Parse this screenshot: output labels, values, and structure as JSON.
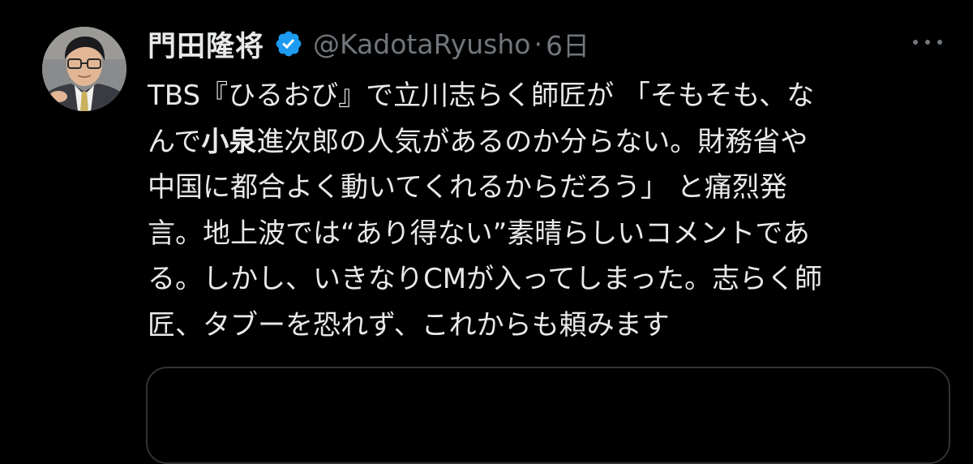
{
  "author": {
    "display_name": "門田隆将",
    "handle": "@KadotaRyusho",
    "separator": "·",
    "time": "6日",
    "verified": true,
    "verified_color": "#1d9bf0"
  },
  "tweet": {
    "lines": [
      [
        {
          "text": "TBS『ひるおび』で立川志らく師匠が 「そもそも、な"
        }
      ],
      [
        {
          "text": "んで"
        },
        {
          "text": "小泉",
          "bold": true
        },
        {
          "text": "進次郎の人気があるのか分らない。財務省や"
        }
      ],
      [
        {
          "text": "中国に都合よく動いてくれるからだろう」 と痛烈発"
        }
      ],
      [
        {
          "text": "言。地上波では“あり得ない”素晴らしいコメントであ"
        }
      ],
      [
        {
          "text": "る。しかし、いきなりCMが入ってしまった。志らく師"
        }
      ],
      [
        {
          "text": "匠、タブーを恐れず、これからも頼みます"
        }
      ]
    ]
  },
  "icons": {
    "avatar": "profile-photo",
    "verified": "verified-badge-icon",
    "more": "more-options-icon"
  },
  "colors": {
    "background": "#000000",
    "text": "#e7e9ea",
    "secondary": "#71767b",
    "border": "#2f3336"
  }
}
